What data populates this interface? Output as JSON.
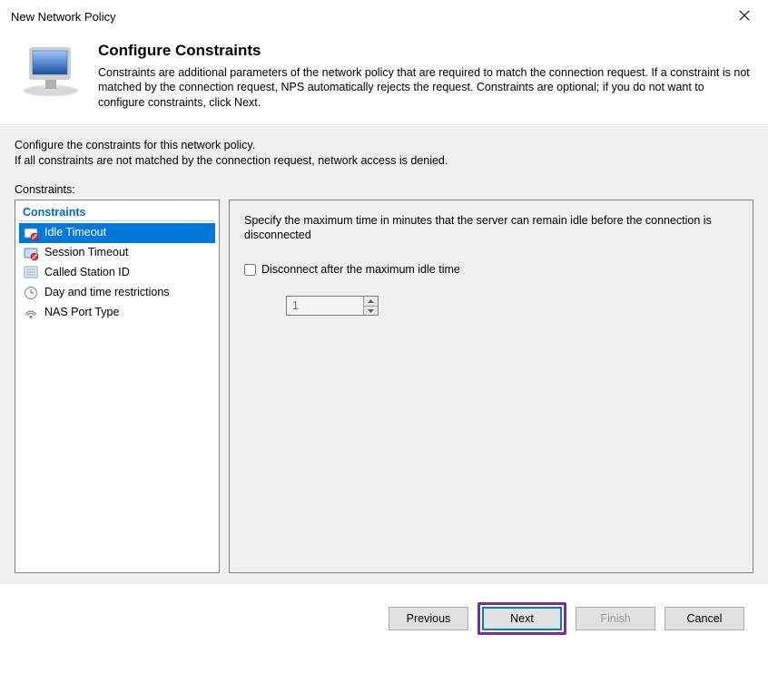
{
  "window": {
    "title": "New Network Policy"
  },
  "header": {
    "title": "Configure Constraints",
    "description": "Constraints are additional parameters of the network policy that are required to match the connection request. If a constraint is not matched by the connection request, NPS automatically rejects the request. Constraints are optional; if you do not want to configure constraints, click Next."
  },
  "body": {
    "intro_line1": "Configure the constraints for this network policy.",
    "intro_line2": "If all constraints are not matched by the connection request, network access is denied.",
    "category_label": "Constraints:"
  },
  "tree": {
    "header": "Constraints",
    "items": [
      {
        "label": "Idle Timeout",
        "selected": true,
        "icon": "idle-timeout"
      },
      {
        "label": "Session Timeout",
        "selected": false,
        "icon": "session-timeout"
      },
      {
        "label": "Called Station ID",
        "selected": false,
        "icon": "called-station"
      },
      {
        "label": "Day and time restrictions",
        "selected": false,
        "icon": "day-time"
      },
      {
        "label": "NAS Port Type",
        "selected": false,
        "icon": "nas-port"
      }
    ]
  },
  "detail": {
    "description": "Specify the maximum time in minutes that the server can remain idle before the connection is disconnected",
    "checkbox_label": "Disconnect after the maximum idle time",
    "checkbox_checked": false,
    "spinner_value": "1"
  },
  "footer": {
    "previous": "Previous",
    "next": "Next",
    "finish": "Finish",
    "cancel": "Cancel"
  }
}
